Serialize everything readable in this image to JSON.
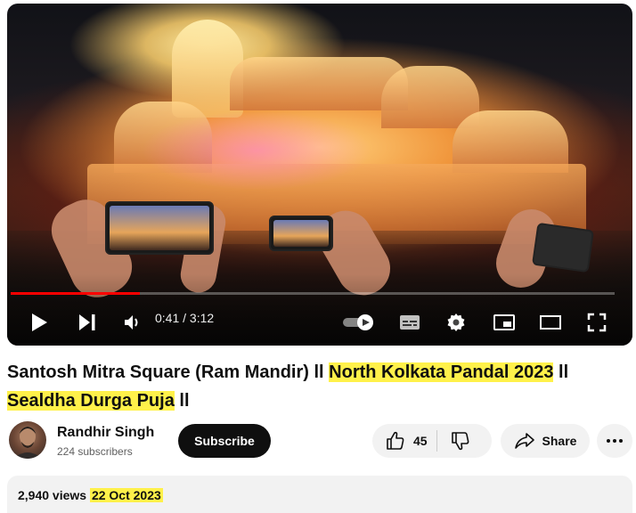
{
  "player": {
    "current_time": "0:41",
    "separator": " / ",
    "duration": "3:12",
    "progress_fraction": 0.214
  },
  "video": {
    "title_part1": "Santosh Mitra Square (Ram Mandir) ll ",
    "title_highlight1": "North Kolkata Pandal 2023",
    "title_part2": " ll",
    "title_highlight2": "Sealdha Durga Puja",
    "title_part3": " ll"
  },
  "channel": {
    "name": "Randhir Singh",
    "subscribers": "224 subscribers",
    "subscribe_label": "Subscribe"
  },
  "actions": {
    "like_count": "45",
    "share_label": "Share"
  },
  "description": {
    "views": "2,940 views",
    "date": "22 Oct 2023"
  },
  "colors": {
    "progress": "#ff0000",
    "highlight": "#fff14a",
    "subscribe_bg": "#0f0f0f"
  }
}
